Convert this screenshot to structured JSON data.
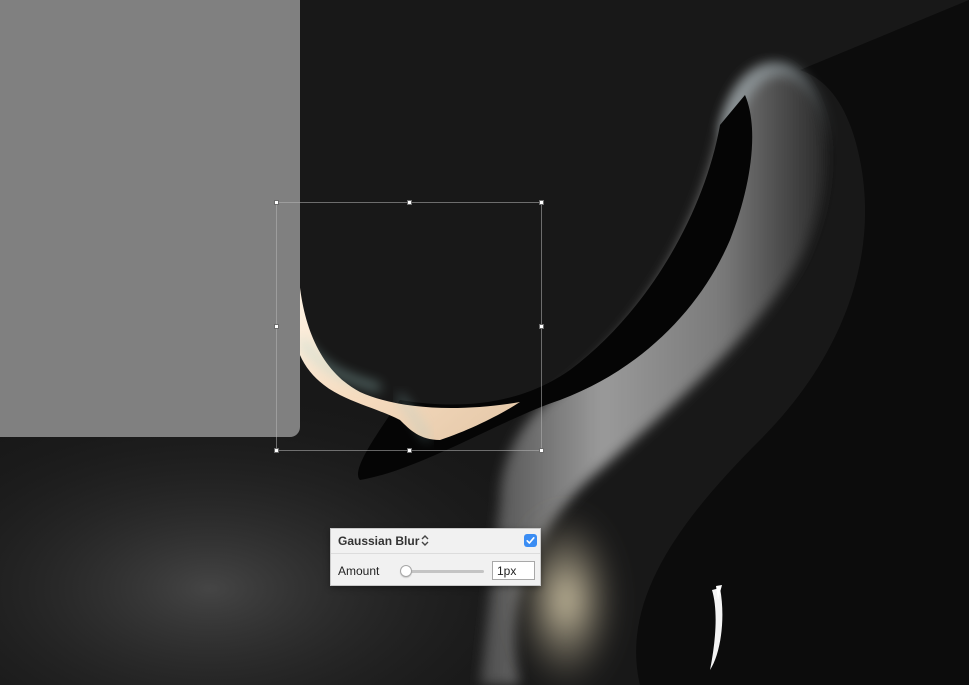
{
  "effect_panel": {
    "effect_name": "Gaussian Blur",
    "effect_enabled": true,
    "amount_label": "Amount",
    "amount_value": "1px",
    "amount_slider_fraction": 0.0
  },
  "icons": {
    "effect_chevron": "up-down-chevron-icon",
    "enable_check": "checkmark-icon"
  },
  "colors": {
    "canvas_background": "#181818",
    "rectangle_fill": "#808080",
    "checkbox_accent": "#3b8df3"
  }
}
